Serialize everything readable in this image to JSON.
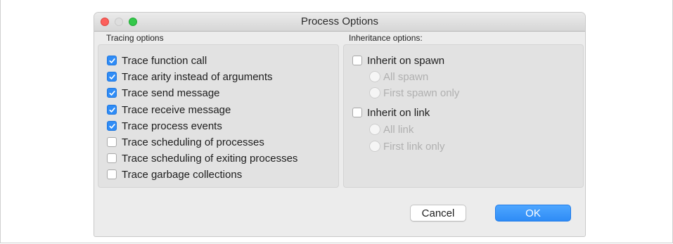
{
  "window": {
    "title": "Process Options"
  },
  "tracing": {
    "label": "Tracing options",
    "items": [
      {
        "label": "Trace function call",
        "checked": true
      },
      {
        "label": "Trace arity instead of arguments",
        "checked": true
      },
      {
        "label": "Trace send message",
        "checked": true
      },
      {
        "label": "Trace receive message",
        "checked": true
      },
      {
        "label": "Trace process events",
        "checked": true
      },
      {
        "label": "Trace scheduling of processes",
        "checked": false
      },
      {
        "label": "Trace scheduling of exiting processes",
        "checked": false
      },
      {
        "label": "Trace garbage collections",
        "checked": false
      }
    ]
  },
  "inheritance": {
    "label": "Inheritance options:",
    "spawn": {
      "label": "Inherit on spawn",
      "checked": false,
      "options": [
        "All spawn",
        "First spawn only"
      ]
    },
    "link": {
      "label": "Inherit on link",
      "checked": false,
      "options": [
        "All link",
        "First link only"
      ]
    }
  },
  "buttons": {
    "cancel": "Cancel",
    "ok": "OK"
  },
  "colors": {
    "accent": "#2f8cf6",
    "close": "#fc605c",
    "maximize": "#34c84a"
  }
}
